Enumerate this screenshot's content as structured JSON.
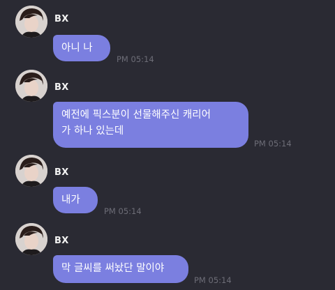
{
  "sender": {
    "name": "BX"
  },
  "messages": [
    {
      "text": "아니 나",
      "time": "PM 05:14"
    },
    {
      "text": "예전에 픽스분이 선물해주신 캐리어\n가 하나 있는데",
      "time": "PM 05:14"
    },
    {
      "text": "내가",
      "time": "PM 05:14"
    },
    {
      "text": "막 글씨를 써놨단 말이야",
      "time": "PM 05:14"
    }
  ],
  "colors": {
    "background": "#2a2a33",
    "bubble": "#7b7fe0",
    "name": "#f2f2f2",
    "timestamp": "#6d6d77"
  }
}
